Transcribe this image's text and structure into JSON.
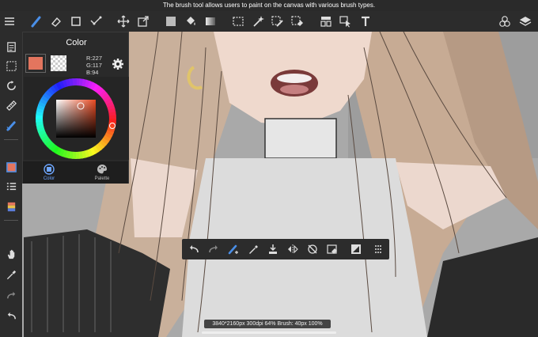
{
  "tip": "The brush tool allows users to paint on the canvas with various brush types.",
  "top_toolbar": {
    "icons": [
      "menu-icon",
      "brush-icon",
      "eraser-icon",
      "shape-rect-icon",
      "fill-lines-icon",
      "move-icon",
      "transform-icon",
      "fill-color-icon",
      "bucket-icon",
      "gradient-icon",
      "select-rect-icon",
      "magic-wand-icon",
      "select-pen-icon",
      "select-eraser-icon",
      "layout-icon",
      "select-arrow-icon",
      "text-icon",
      "materials-icon",
      "layers-icon"
    ]
  },
  "left_toolbar": {
    "icons": [
      "pages-icon",
      "selection-icon",
      "rotate-icon",
      "ruler-icon",
      "brush-settings-icon",
      "color-icon",
      "layer-list-icon",
      "material-icon",
      "hand-icon",
      "eyedropper-icon",
      "redo-icon",
      "undo-icon"
    ]
  },
  "color_panel": {
    "title": "Color",
    "main_color": "#e3755e",
    "r_label": "R:227",
    "g_label": "G:117",
    "b_label": "B:94",
    "tabs": [
      {
        "label": "Color",
        "active": true
      },
      {
        "label": "Palette",
        "active": false
      }
    ]
  },
  "bottom_toolbar": {
    "icons": [
      "undo-icon",
      "redo-icon",
      "brush-settings-icon",
      "eyedropper-icon",
      "save-icon",
      "flip-icon",
      "snap-off-icon",
      "clear-icon",
      "color-swap-icon",
      "more-icon"
    ]
  },
  "status_text": "3840*2160px 300dpi 64% Brush: 40px 100%",
  "colors": {
    "accent": "#6ea6ff",
    "toolbar_bg": "#2c2c2c"
  }
}
